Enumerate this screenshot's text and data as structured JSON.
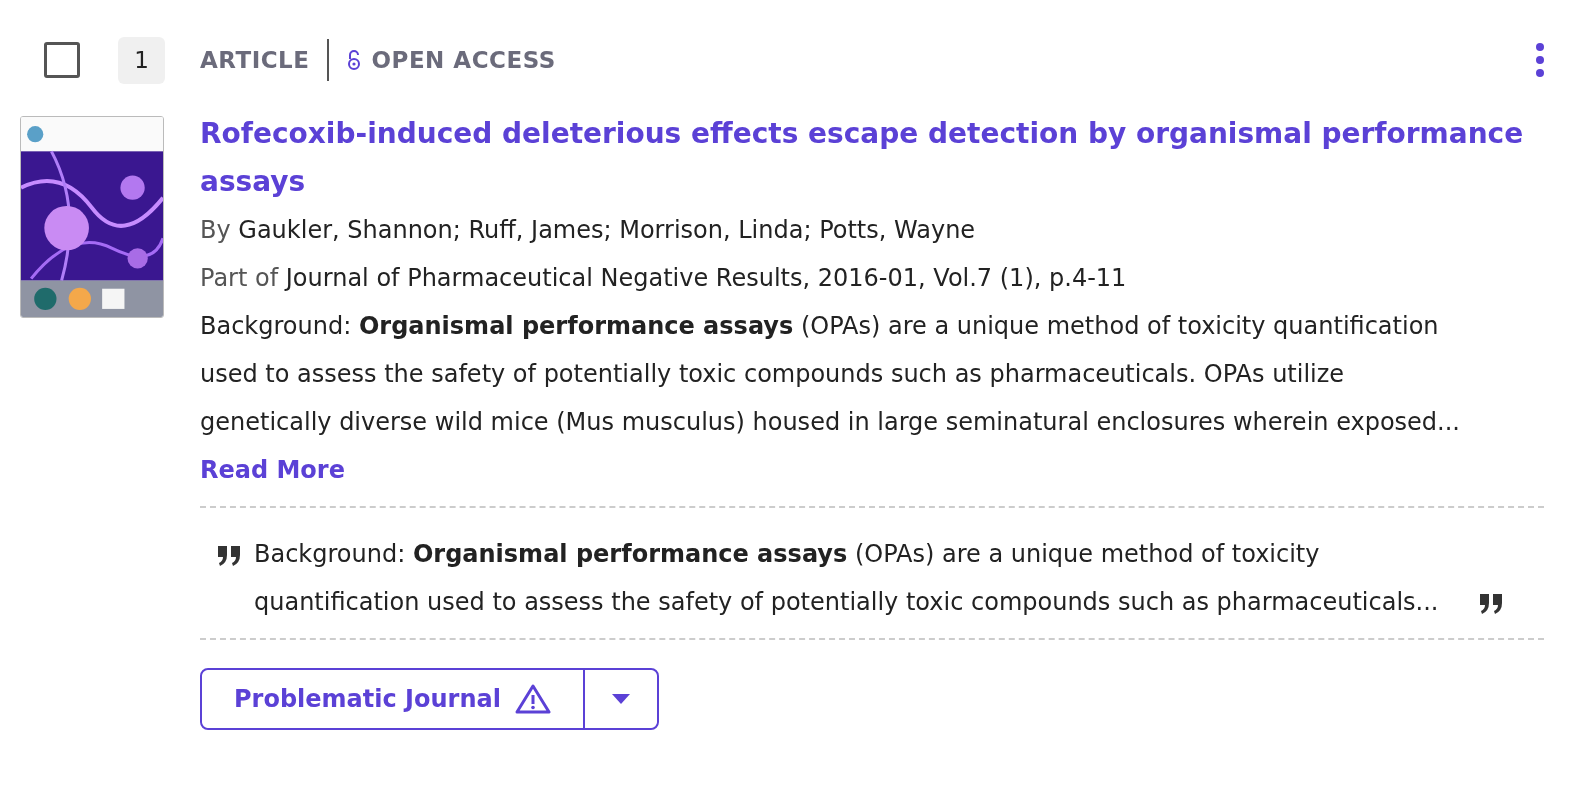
{
  "result": {
    "checked": false,
    "number": "1",
    "type_label": "ARTICLE",
    "access_label": "OPEN ACCESS",
    "title": "Rofecoxib-induced deleterious effects escape detection by organismal performance assays",
    "authors_prefix": "By",
    "authors": "Gaukler, Shannon; Ruff, James; Morrison, Linda; Potts, Wayne",
    "source_prefix": "Part of",
    "source": "Journal of Pharmaceutical Negative Results, 2016-01, Vol.7 (1), p.4-11",
    "abstract": "Background: **Organismal performance assays** (OPAs) are a unique method of toxicity quantification used to assess the safety of potentially toxic compounds such as pharmaceuticals. OPAs utilize genetically diverse wild mice (Mus musculus) housed in large seminatural enclosures wherein exposed...",
    "read_more": "Read More",
    "snippet": "Background: **Organismal performance assays** (OPAs) are a unique method of toxicity quantification used to assess the safety of potentially toxic compounds such as pharmaceuticals...",
    "action_button": "Problematic Journal"
  }
}
